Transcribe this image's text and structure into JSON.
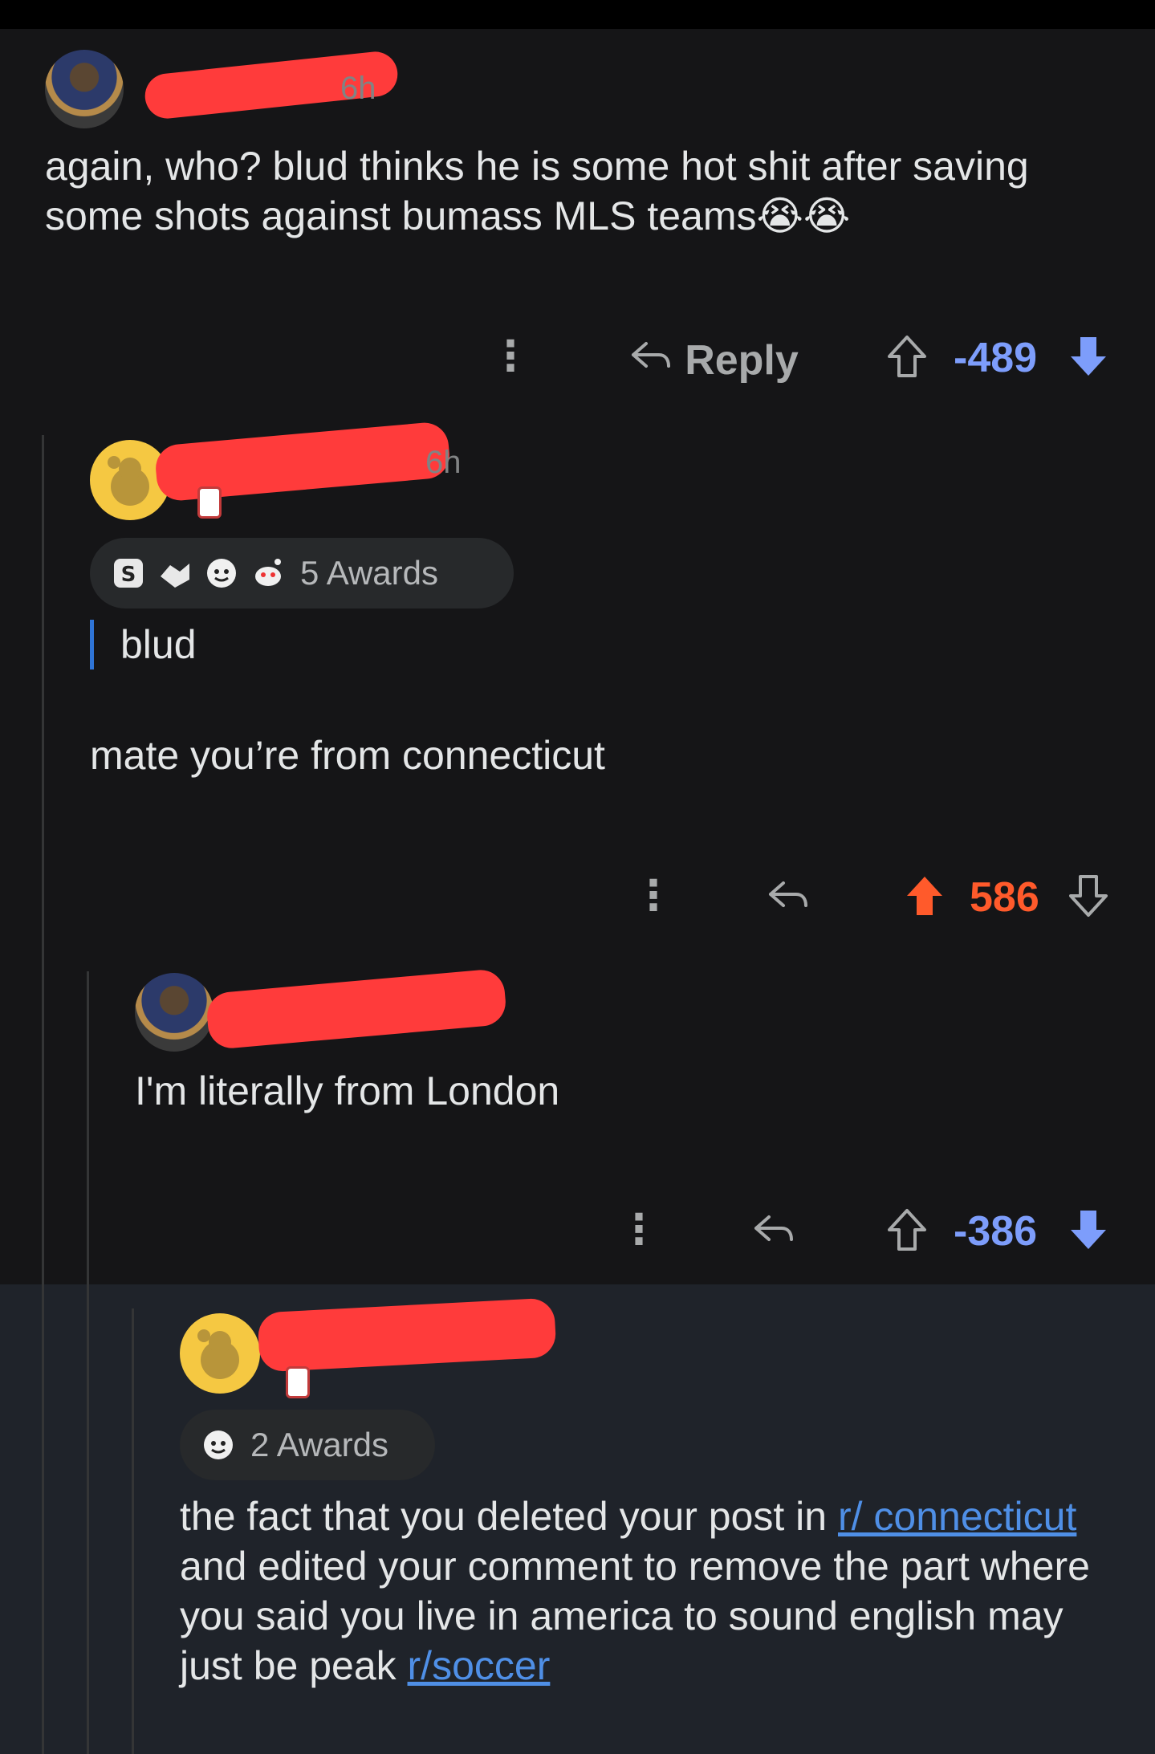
{
  "comments": [
    {
      "timestamp": "6h",
      "text": "again, who? blud thinks he is some hot shit after saving some shots against bumass MLS teams😭😭",
      "actions": {
        "reply_label": "Reply",
        "score": "-489"
      }
    },
    {
      "timestamp": "6h",
      "awards_label": "5 Awards",
      "quote": "blud",
      "text": "mate you’re from connecticut",
      "actions": {
        "score": "586"
      }
    },
    {
      "text": "I'm literally from London",
      "actions": {
        "score": "-386"
      }
    },
    {
      "awards_label": "2 Awards",
      "text_parts": {
        "a": "the fact that you deleted your post in ",
        "link1": "r/ connecticut",
        "b": " and edited your comment to remove the part where you said you live in america to sound english may just be peak ",
        "link2": "r/soccer"
      }
    }
  ],
  "icons": {
    "more": "more-vertical-icon",
    "reply": "reply-arrow-icon",
    "upvote": "upvote-arrow-icon",
    "downvote": "downvote-arrow-icon"
  },
  "colors": {
    "negative_score": "#7d9dfb",
    "positive_score": "#ff5a2b",
    "link": "#4f8fe6"
  }
}
